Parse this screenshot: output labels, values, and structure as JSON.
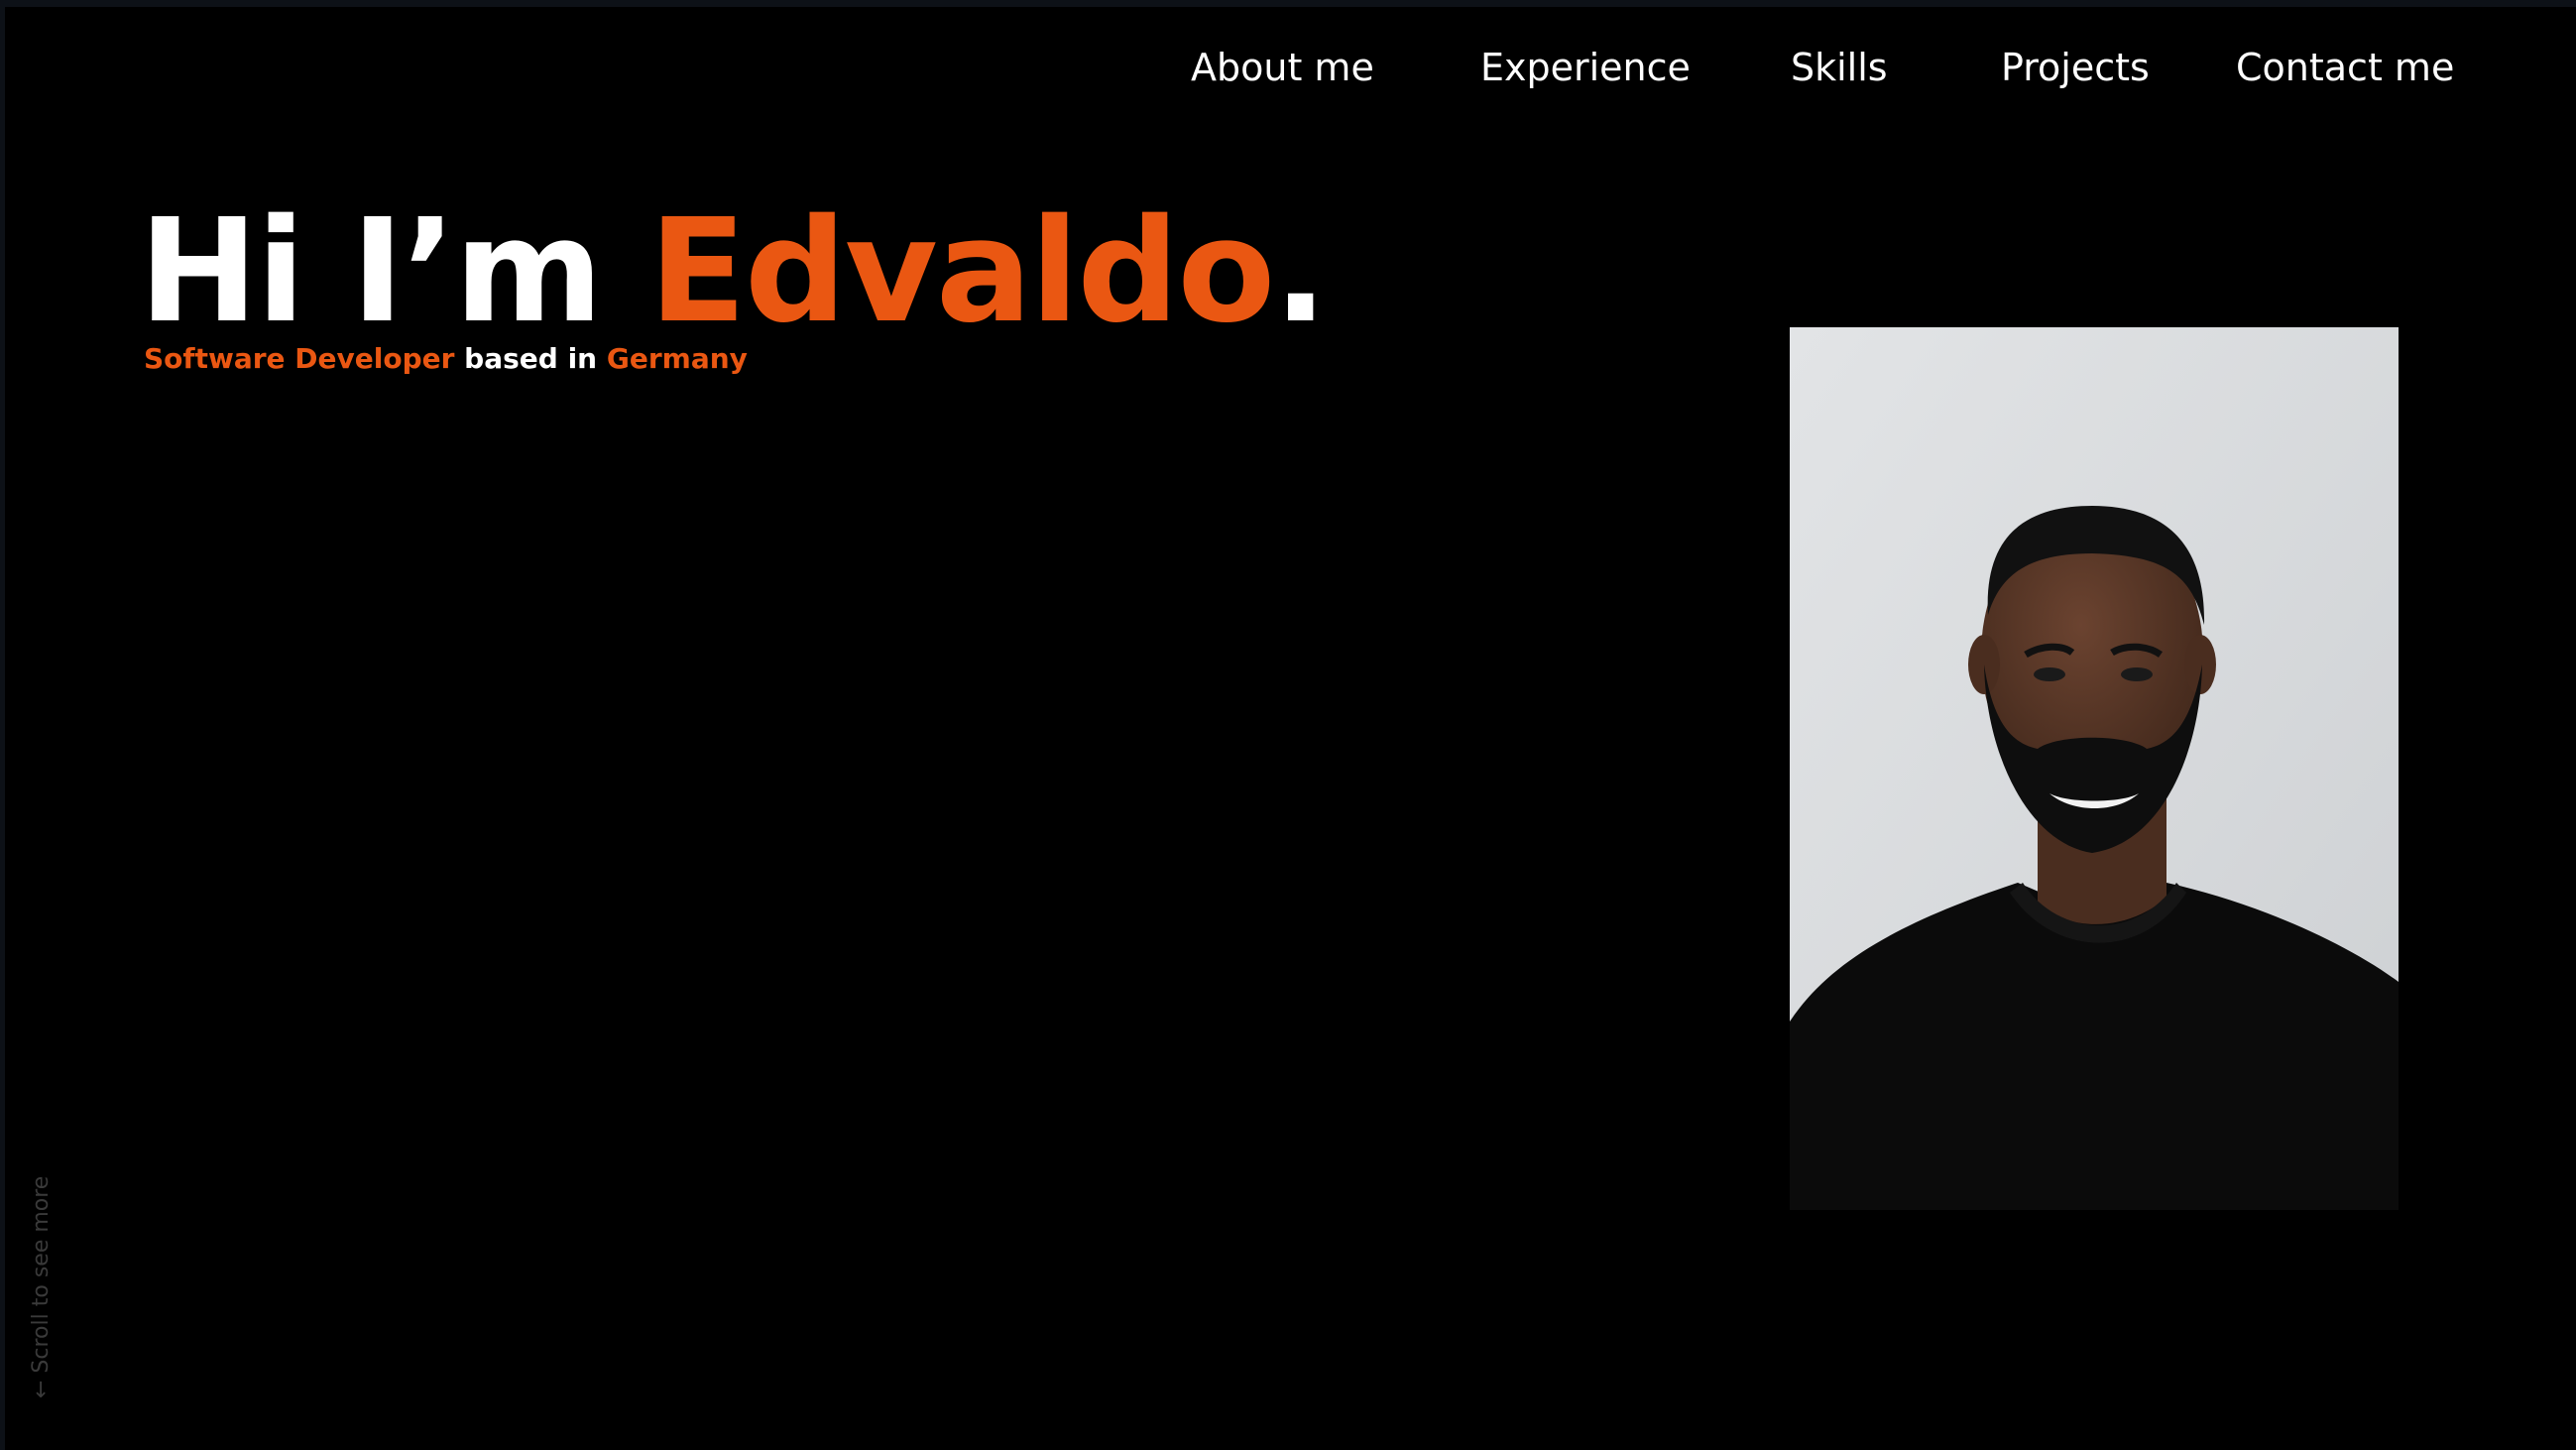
{
  "colors": {
    "background": "#000000",
    "accent": "#ea5712",
    "text": "#ffffff",
    "muted": "#3a3a3a"
  },
  "nav": {
    "items": [
      {
        "label": "About me"
      },
      {
        "label": "Experience"
      },
      {
        "label": "Skills"
      },
      {
        "label": "Projects"
      },
      {
        "label": "Contact me"
      }
    ]
  },
  "hero": {
    "greeting": "Hi I’m ",
    "name": "Edvaldo",
    "dot": ".",
    "role": "Software Developer",
    "based_in": " based in ",
    "location": "Germany"
  },
  "photo": {
    "alt": "Portrait of Edvaldo"
  },
  "scroll_hint": {
    "arrow": "←",
    "label": "Scroll to see more"
  }
}
